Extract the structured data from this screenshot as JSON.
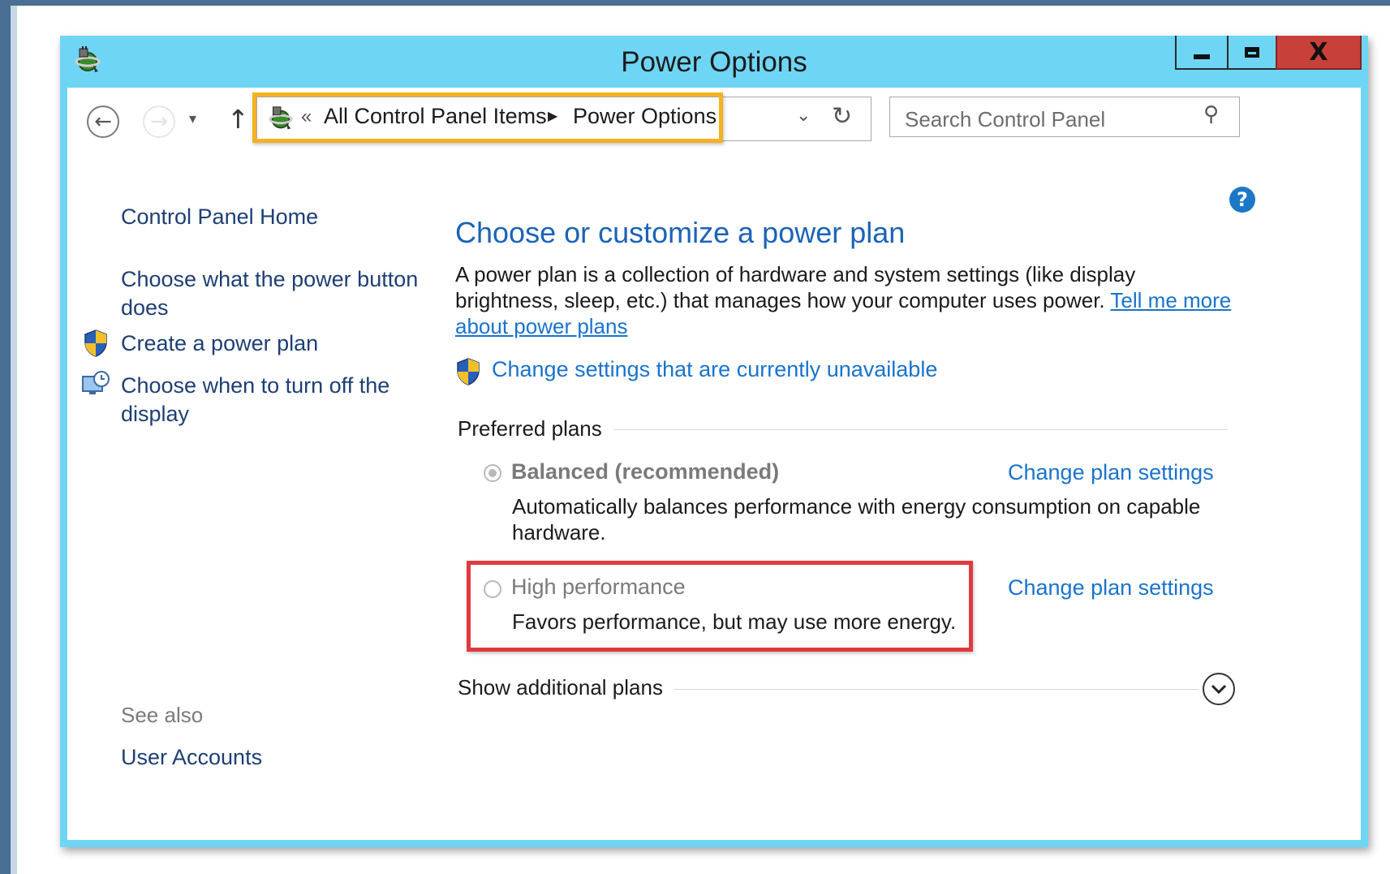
{
  "window": {
    "title": "Power Options",
    "colors": {
      "frame": "#6fd5f5",
      "close": "#c8403a",
      "link": "#1a73cc",
      "address_highlight": "#f5b120",
      "plan_highlight": "#e03a3e"
    }
  },
  "address": {
    "icon": "control-panel-icon",
    "crumbs": [
      "All Control Panel Items",
      "Power Options"
    ]
  },
  "search": {
    "placeholder": "Search Control Panel"
  },
  "sidebar": {
    "home": "Control Panel Home",
    "links": [
      "Choose what the power button does",
      "Create a power plan",
      "Choose when to turn off the display"
    ],
    "see_also": "See also",
    "see_also_links": [
      "User Accounts"
    ]
  },
  "main": {
    "title": "Choose or customize a power plan",
    "description": "A power plan is a collection of hardware and system settings (like display brightness, sleep, etc.) that manages how your computer uses power.",
    "more_link": "Tell me more about power plans",
    "change_unavailable": "Change settings that are currently unavailable",
    "preferred_plans_label": "Preferred plans",
    "plans": [
      {
        "name": "Balanced (recommended)",
        "description": "Automatically balances performance with energy consumption on capable hardware.",
        "selected": true,
        "change_link": "Change plan settings"
      },
      {
        "name": "High performance",
        "description": "Favors performance, but may use more energy.",
        "selected": false,
        "change_link": "Change plan settings"
      }
    ],
    "show_additional": "Show additional plans"
  }
}
